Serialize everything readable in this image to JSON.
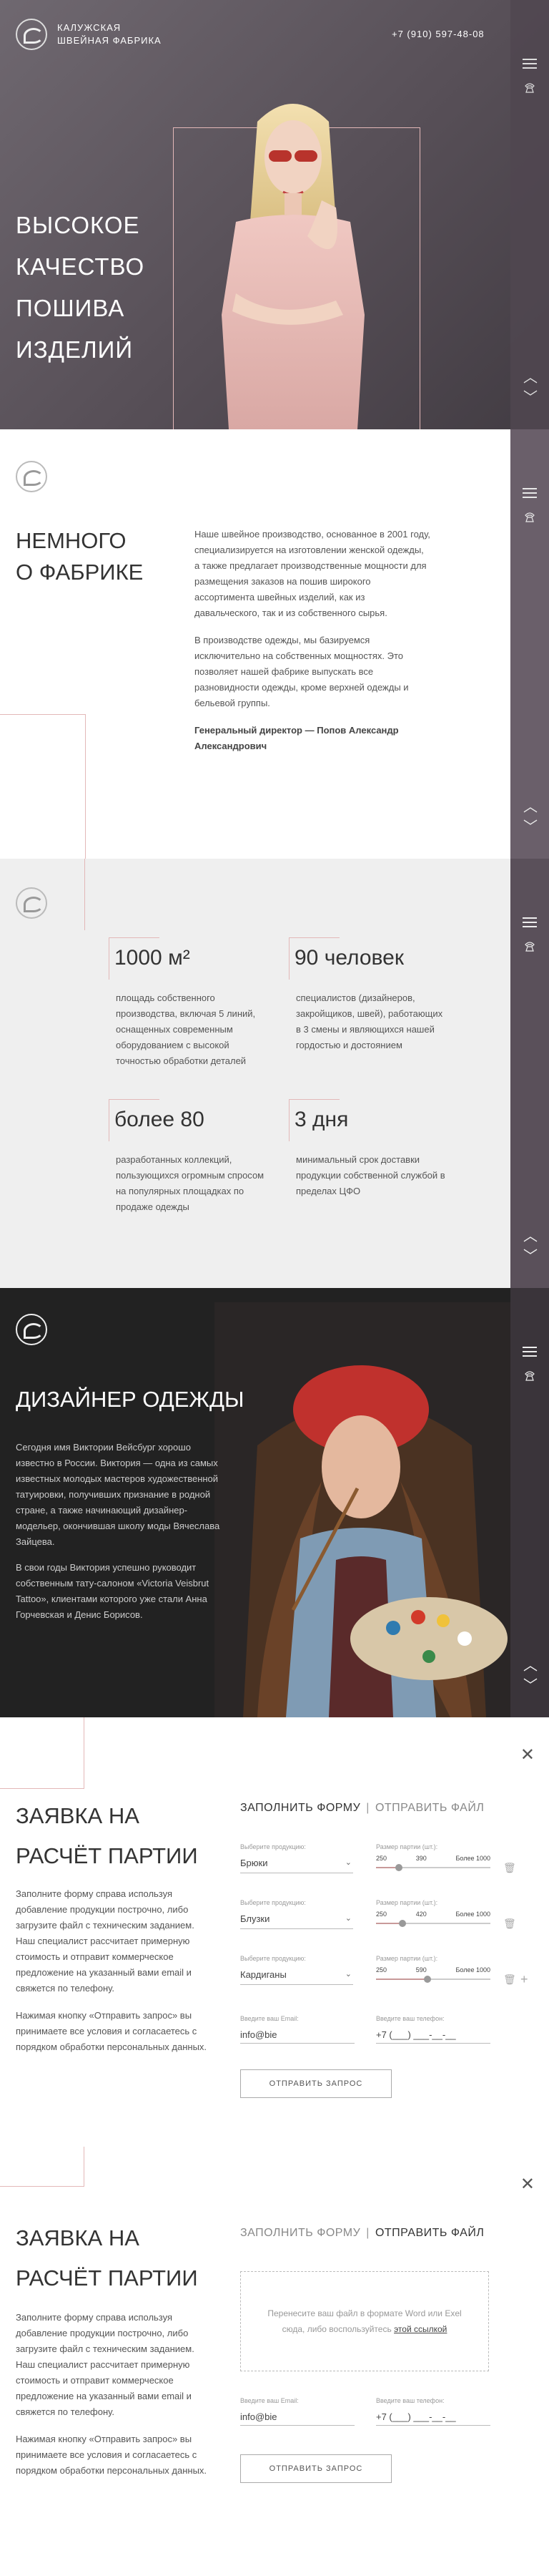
{
  "hero": {
    "brand_line1": "Калужская",
    "brand_line2": "швейная фабрика",
    "phone": "+7 (910) 597-48-08",
    "headline": [
      "Высокое",
      "качество",
      "пошива",
      "изделий"
    ]
  },
  "about": {
    "title_line1": "Немного",
    "title_line2": "о фабрике",
    "p1": "Наше швейное производство, основанное в 2001 году, специализируется на изготовлении женской одежды, а также предлагает производственные мощности для размещения заказов на пошив широкого ассортимента швейных изделий, как из давальческого, так и из собственного сырья.",
    "p2": "В производстве одежды, мы базируемся исключительно на собственных мощностях. Это позволяет нашей фабрике выпускать все разновидности одежды, кроме верхней одежды и бельевой группы.",
    "signature": "Генеральный директор — Попов Александр Александрович"
  },
  "stats": {
    "items": [
      {
        "num": "1000 м²",
        "desc": "площадь собственного производства, включая 5 линий, оснащенных современным оборудованием с высокой точностью обработки деталей"
      },
      {
        "num": "90 человек",
        "desc": "специалистов (дизайнеров, закройщиков, швей), работающих в 3 смены и являющихся нашей гордостью и достоянием"
      },
      {
        "num": "более 80",
        "desc": "разработанных коллекций, пользующихся огромным спросом на популярных площадках по продаже одежды"
      },
      {
        "num": "3 дня",
        "desc": "минимальный срок доставки продукции собственной службой в пределах ЦФО"
      }
    ]
  },
  "designer": {
    "title": "Дизайнер одежды",
    "p1": "Сегодня имя Виктории Вейсбург хорошо известно в России. Виктория — одна из самых известных молодых мастеров художественной татуировки, получивших признание в родной стране, а также начинающий дизайнер- модельер, окончившая школу моды Вячеслава Зайцева.",
    "p2": "В свои годы Виктория успешно руководит собственным тату-салоном «Victoria Veisbrut Tattoo», клиентами которого уже стали Анна Горчевская и Денис Борисов."
  },
  "form": {
    "title_line1": "Заявка на",
    "title_line2": "расчёт партии",
    "lead1": "Заполните форму справа используя добавление продукции построчно, либо загрузите файл с техническим заданием. Наш специалист рассчитает примерную стоимость и отправит коммерческое предложение на указанный вами email и свяжется по телефону.",
    "lead2": "Нажимая кнопку «Отправить запрос» вы принимаете все условия и согласаетесь с порядком обработки персональных данных.",
    "tab_fill": "Заполнить форму",
    "tab_file": "Отправить файл",
    "product_label": "Выберите продукцию:",
    "size_label": "Размер партии (шт.):",
    "rows": [
      {
        "product": "Брюки",
        "min": "250",
        "value": "390",
        "max": "Более 1000",
        "fraction": 0.2
      },
      {
        "product": "Блузки",
        "min": "250",
        "value": "420",
        "max": "Более 1000",
        "fraction": 0.23
      },
      {
        "product": "Кардиганы",
        "min": "250",
        "value": "590",
        "max": "Более 1000",
        "fraction": 0.45
      }
    ],
    "email_label": "Введите ваш Email:",
    "email_value": "info@bie",
    "phone_label": "Введите ваш телефон:",
    "phone_value": "+7 (___) ___-__-__",
    "submit": "Отправить запрос",
    "dropzone_text": "Перенесите ваш файл в формате Word или Exel сюда, либо воспользуйтесь",
    "dropzone_link": "этой ссылкой"
  }
}
